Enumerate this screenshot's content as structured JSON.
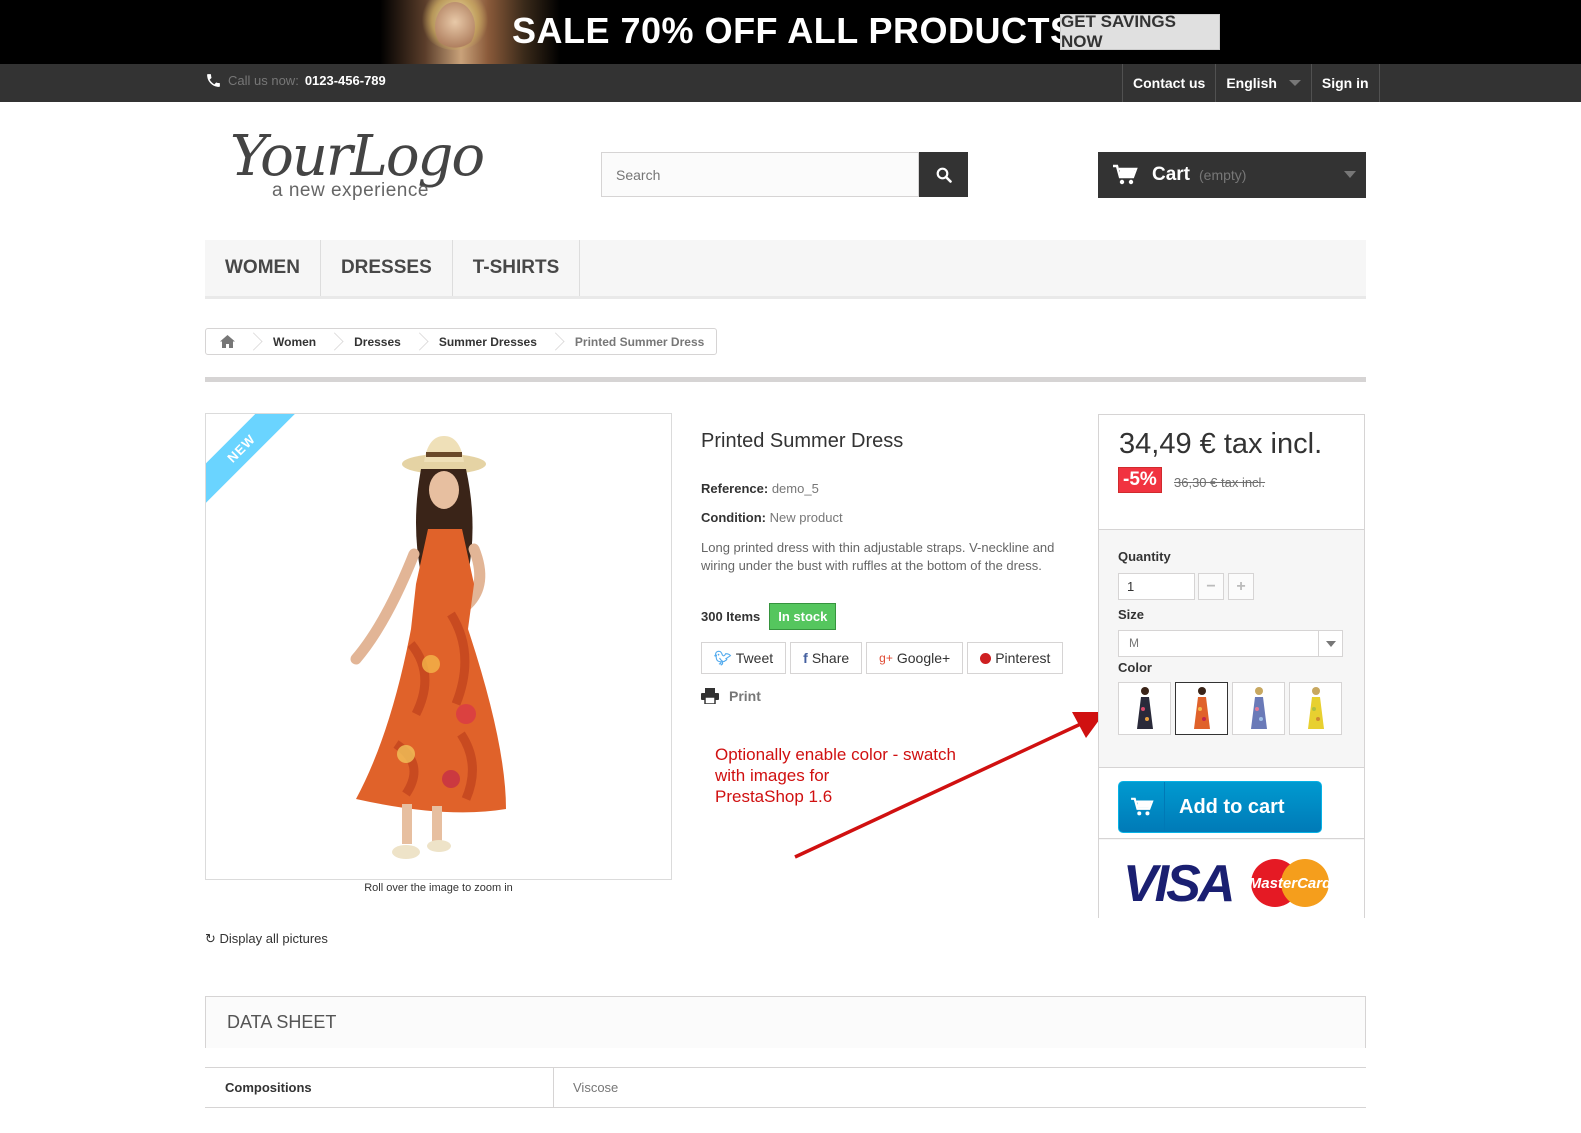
{
  "banner": {
    "title": "SALE 70% OFF ALL PRODUCTS",
    "button": "GET SAVINGS NOW"
  },
  "topnav": {
    "call_prefix": "Call us now:",
    "phone": "0123-456-789",
    "contact": "Contact us",
    "language": "English",
    "signin": "Sign in"
  },
  "logo": {
    "script": "YourLogo",
    "tagline": "a new experience"
  },
  "search": {
    "placeholder": "Search"
  },
  "cart": {
    "label": "Cart",
    "status": "(empty)"
  },
  "menu": [
    "WOMEN",
    "DRESSES",
    "T-SHIRTS"
  ],
  "breadcrumb": [
    "Women",
    "Dresses",
    "Summer Dresses",
    "Printed Summer Dress"
  ],
  "product": {
    "badge": "NEW",
    "zoom_caption": "Roll over the image to zoom in",
    "display_all": "Display all pictures",
    "name": "Printed Summer Dress",
    "reference_label": "Reference:",
    "reference": "demo_5",
    "condition_label": "Condition:",
    "condition": "New product",
    "description": "Long printed dress with thin adjustable straps. V-neckline and wiring under the bust with ruffles at the bottom of the dress.",
    "quantity_available": "300 Items",
    "stock_status": "In stock",
    "share": {
      "tweet": "Tweet",
      "share": "Share",
      "google": "Google+",
      "pinterest": "Pinterest"
    },
    "print": "Print"
  },
  "annotation": {
    "line1": "Optionally enable color - swatch",
    "line2": "with images for",
    "line3": "PrestaShop 1.6"
  },
  "buy": {
    "price": "34,49 € tax incl.",
    "discount": "-5%",
    "old_price": "36,30 € tax incl.",
    "quantity_label": "Quantity",
    "quantity_value": "1",
    "size_label": "Size",
    "size_value": "M",
    "color_label": "Color",
    "add_to_cart": "Add to cart",
    "payment_visa": "VISA",
    "payment_mc": "MasterCard"
  },
  "datasheet": {
    "title": "DATA SHEET",
    "rows": [
      {
        "key": "Compositions",
        "value": "Viscose"
      }
    ]
  },
  "colors": {
    "accent_blue": "#0a8ecb",
    "new_ribbon": "#6ad4ff",
    "in_stock": "#55c65e",
    "discount_red": "#f13340",
    "annotation_red": "#d01010"
  }
}
